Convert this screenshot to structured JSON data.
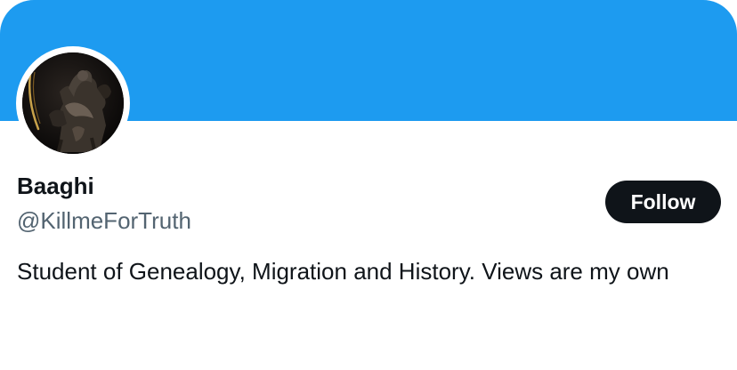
{
  "profile": {
    "display_name": "Baaghi",
    "handle": "@KillmeForTruth",
    "bio": "Student of Genealogy, Migration and History. Views are my own",
    "follow_label": "Follow",
    "banner_color": "#1d9bf0",
    "avatar_icon": "avatar-image"
  }
}
